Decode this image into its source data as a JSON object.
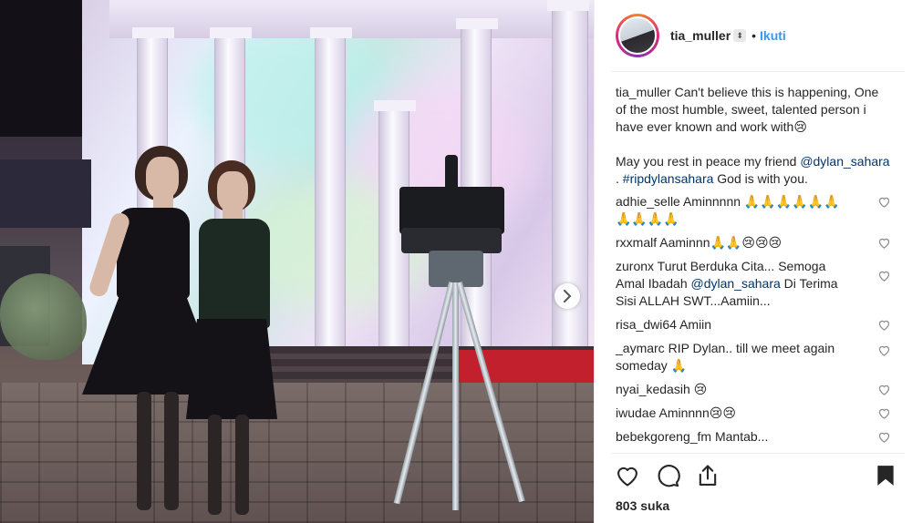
{
  "post": {
    "username": "tia_muller",
    "verified_glyph": "⬍",
    "follow_separator": "•",
    "follow_label": "Ikuti",
    "caption": {
      "author": "tia_muller",
      "line1": "Can't believe this is happening, One of the most humble, sweet, talented person i have ever known and work with😢",
      "line2_prefix": "May you rest in peace my friend ",
      "mention": "@dylan_sahara",
      "sep": " . ",
      "hashtag": "#ripdylansahara",
      "line2_suffix": " God is with you."
    },
    "comments": [
      {
        "user": "adhie_selle",
        "text": "Aminnnnn 🙏🙏🙏🙏🙏🙏🙏🙏🙏🙏"
      },
      {
        "user": "rxxmalf",
        "text": "Aaminnn🙏🙏😢😢😢"
      },
      {
        "user": "zuronx",
        "text_prefix": "Turut Berduka Cita... Semoga Amal Ibadah ",
        "mention": "@dylan_sahara",
        "text_suffix": " Di Terima Sisi ALLAH SWT...Aamiin..."
      },
      {
        "user": "risa_dwi64",
        "text": "Amiin"
      },
      {
        "user": "_aymarc",
        "text": "RIP Dylan.. till we meet again someday 🙏"
      },
      {
        "user": "nyai_kedasih",
        "text": "😢"
      },
      {
        "user": "iwudae",
        "text": "Aminnnn😢😢"
      },
      {
        "user": "bebekgoreng_fm",
        "text": "Mantab..."
      }
    ],
    "likes": "803 suka"
  },
  "icons": {
    "like": "heart-icon",
    "comment": "comment-icon",
    "share": "share-icon",
    "save": "bookmark-icon",
    "next": "chevron-right-icon"
  },
  "colors": {
    "link": "#3897f0",
    "mention": "#003569",
    "text": "#262626"
  }
}
